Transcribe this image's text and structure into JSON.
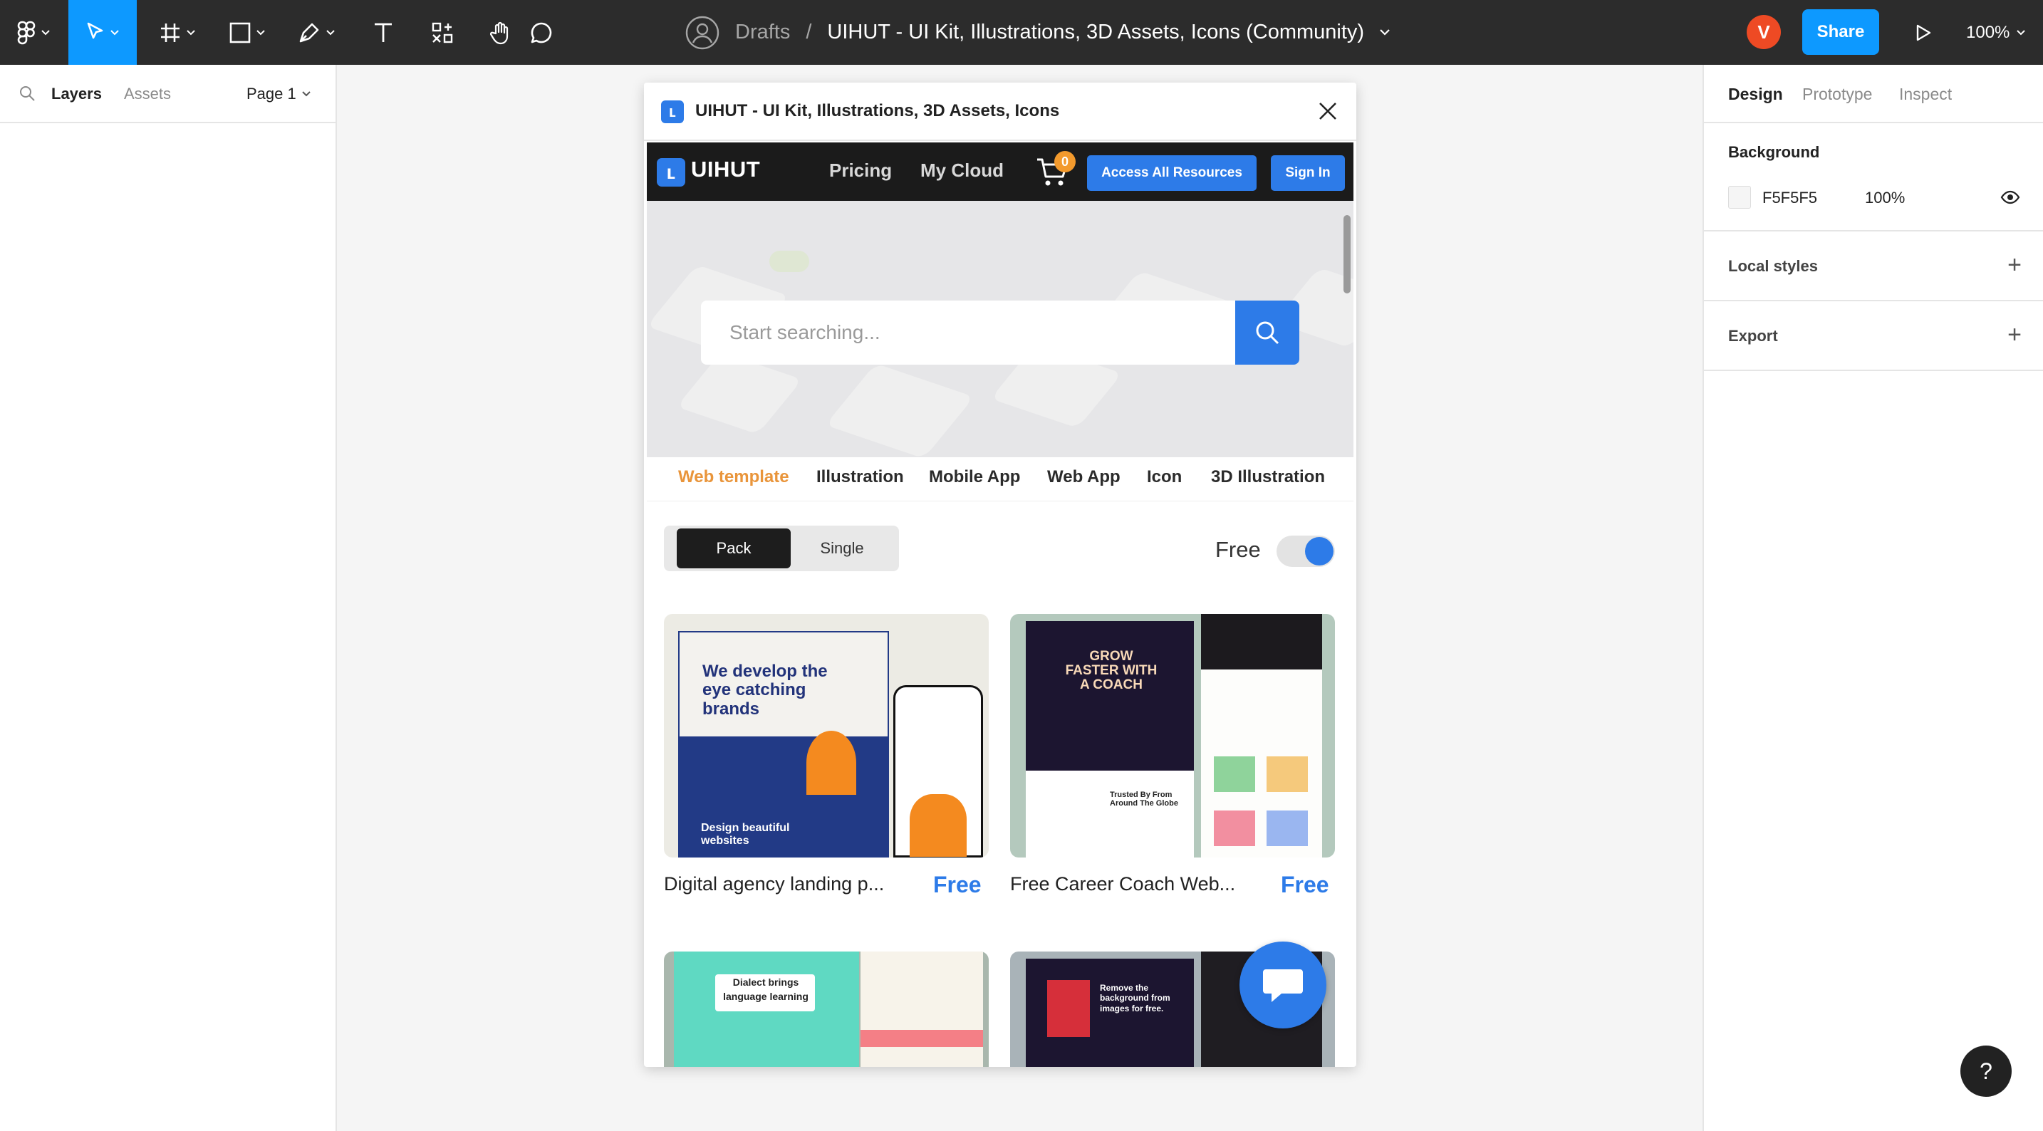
{
  "toolbar": {
    "breadcrumb_root": "Drafts",
    "breadcrumb_separator": "/",
    "file_title": "UIHUT - UI Kit, Illustrations, 3D Assets, Icons (Community)",
    "avatar_initial": "V",
    "share_label": "Share",
    "zoom": "100%",
    "accent": "#0d99ff"
  },
  "left_panel": {
    "tabs": [
      "Layers",
      "Assets"
    ],
    "page": "Page 1"
  },
  "right_panel": {
    "tabs": [
      "Design",
      "Prototype",
      "Inspect"
    ],
    "background_title": "Background",
    "bg_hex": "F5F5F5",
    "bg_opacity": "100%",
    "local_styles": "Local styles",
    "export": "Export"
  },
  "plugin": {
    "title": "UIHUT - UI Kit, Illustrations, 3D Assets, Icons",
    "site": {
      "brand": "UIHUT",
      "nav": [
        "Pricing",
        "My Cloud"
      ],
      "cart_count": "0",
      "access_button": "Access All Resources",
      "signin_button": "Sign In",
      "search_placeholder": "Start searching...",
      "categories": [
        "Web template",
        "Illustration",
        "Mobile App",
        "Web App",
        "Icon",
        "3D Illustration"
      ],
      "segments": [
        "Pack",
        "Single"
      ],
      "free_label": "Free",
      "free_toggle_on": true,
      "cards": [
        {
          "caption": "Digital agency landing p...",
          "price": "Free",
          "headline": "We develop the eye catching brands",
          "sub": "Design beautiful websites"
        },
        {
          "caption": "Free Career Coach Web...",
          "price": "Free",
          "headline": "GROW FASTER WITH A COACH",
          "sub": "Trusted By From Around The Globe"
        },
        {
          "headline": "Dialect brings language learning"
        },
        {
          "headline": "Remove the background from images for free."
        }
      ],
      "brand_color": "#2d7be8",
      "active_category_color": "#e9953b"
    }
  }
}
